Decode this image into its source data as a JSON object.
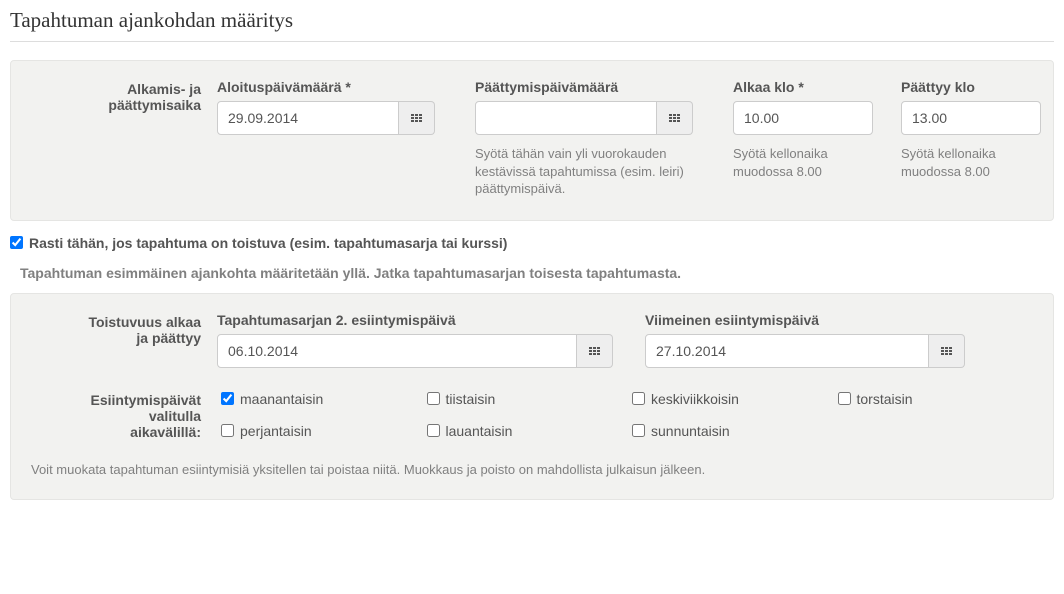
{
  "page_title": "Tapahtuman ajankohdan määritys",
  "section1": {
    "side_label_line1": "Alkamis- ja",
    "side_label_line2": "päättymisaika",
    "start_date_label": "Aloituspäivämäärä *",
    "start_date_value": "29.09.2014",
    "end_date_label": "Päättymispäivämäärä",
    "end_date_value": "",
    "end_date_help": "Syötä tähän vain yli vuorokauden kestävissä tapahtumissa (esim. leiri) päättymispäivä.",
    "start_time_label": "Alkaa klo *",
    "start_time_value": "10.00",
    "start_time_help": "Syötä kellonaika muodossa 8.00",
    "end_time_label": "Päättyy klo",
    "end_time_value": "13.00",
    "end_time_help": "Syötä kellonaika muodossa 8.00"
  },
  "recurrence_checkbox_label": "Rasti tähän, jos tapahtuma on toistuva (esim. tapahtumasarja tai kurssi)",
  "recurrence_info": "Tapahtuman esimmäinen ajankohta määritetään yllä. Jatka tapahtumasarjan toisesta tapahtumasta.",
  "section2": {
    "side_label_line1": "Toistuvuus alkaa",
    "side_label_line2": "ja päättyy",
    "second_date_label": "Tapahtumasarjan 2. esiintymispäivä",
    "second_date_value": "06.10.2014",
    "last_date_label": "Viimeinen esiintymispäivä",
    "last_date_value": "27.10.2014",
    "days_label_line1": "Esiintymispäivät",
    "days_label_line2": "valitulla",
    "days_label_line3": "aikavälillä:",
    "days": {
      "mon": "maanantaisin",
      "tue": "tiistaisin",
      "wed": "keskiviikkoisin",
      "thu": "torstaisin",
      "fri": "perjantaisin",
      "sat": "lauantaisin",
      "sun": "sunnuntaisin"
    },
    "footer_note": "Voit muokata tapahtuman esiintymisiä yksitellen tai poistaa niitä. Muokkaus ja poisto on mahdollista julkaisun jälkeen."
  }
}
